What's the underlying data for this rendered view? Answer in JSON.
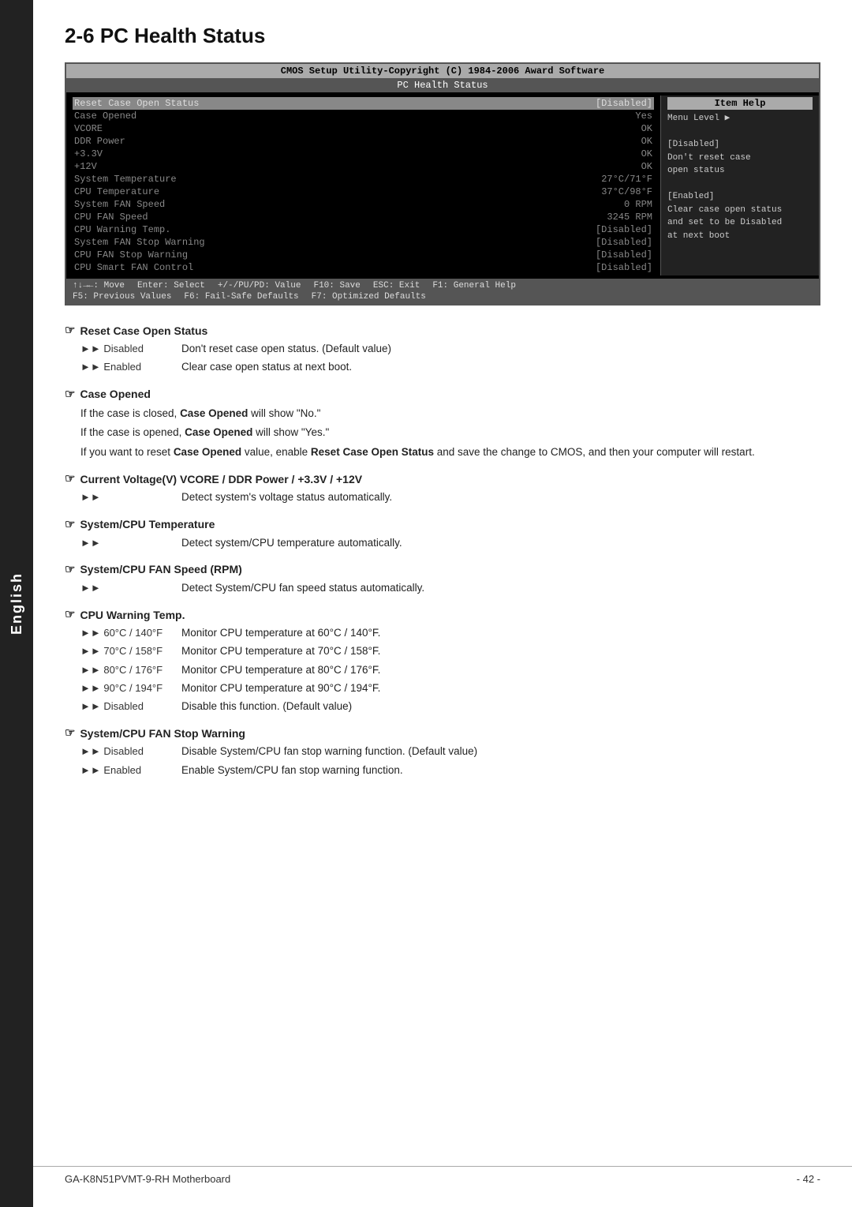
{
  "sidebar": {
    "label": "English"
  },
  "page": {
    "title_number": "2-6",
    "title_text": "PC Health Status"
  },
  "bios": {
    "header": "CMOS Setup Utility-Copyright (C) 1984-2006 Award Software",
    "subheader": "PC Health Status",
    "rows": [
      {
        "label": "Reset Case Open Status",
        "value": "[Disabled]",
        "selected": true,
        "dim": false
      },
      {
        "label": "Case Opened",
        "value": "Yes",
        "selected": false,
        "dim": true
      },
      {
        "label": "VCORE",
        "value": "OK",
        "selected": false,
        "dim": true
      },
      {
        "label": "DDR Power",
        "value": "OK",
        "selected": false,
        "dim": true
      },
      {
        "label": "+3.3V",
        "value": "OK",
        "selected": false,
        "dim": true
      },
      {
        "label": "+12V",
        "value": "OK",
        "selected": false,
        "dim": true
      },
      {
        "label": "System Temperature",
        "value": "27°C/71°F",
        "selected": false,
        "dim": true
      },
      {
        "label": "CPU Temperature",
        "value": "37°C/98°F",
        "selected": false,
        "dim": true
      },
      {
        "label": "System FAN Speed",
        "value": "0 RPM",
        "selected": false,
        "dim": true
      },
      {
        "label": "CPU FAN Speed",
        "value": "3245 RPM",
        "selected": false,
        "dim": true
      },
      {
        "label": "CPU Warning Temp.",
        "value": "[Disabled]",
        "selected": false,
        "dim": true
      },
      {
        "label": "System FAN Stop Warning",
        "value": "[Disabled]",
        "selected": false,
        "dim": true
      },
      {
        "label": "CPU FAN Stop Warning",
        "value": "[Disabled]",
        "selected": false,
        "dim": true
      },
      {
        "label": "CPU Smart FAN Control",
        "value": "[Disabled]",
        "selected": false,
        "dim": true
      }
    ],
    "help": {
      "title": "Item Help",
      "lines": [
        "Menu Level  ▶",
        "",
        "[Disabled]",
        "Don't reset case",
        "open status",
        "",
        "[Enabled]",
        "Clear case open status",
        "and set to be Disabled",
        "at next boot"
      ]
    },
    "footer": {
      "line1_left": "↑↓→←: Move",
      "line1_mid": "Enter: Select",
      "line1_right": "+/-/PU/PD: Value",
      "line1_f10": "F10: Save",
      "line1_esc": "ESC: Exit",
      "line1_f1": "F1: General Help",
      "line2_f5": "F5: Previous Values",
      "line2_f6": "F6: Fail-Safe Defaults",
      "line2_f7": "F7: Optimized Defaults"
    }
  },
  "sections": [
    {
      "id": "reset-case-open-status",
      "title": "Reset Case Open Status",
      "bullets": [
        {
          "label": "Disabled",
          "text": "Don't reset case open status. (Default value)"
        },
        {
          "label": "Enabled",
          "text": "Clear case open status at next boot."
        }
      ],
      "paragraphs": []
    },
    {
      "id": "case-opened",
      "title": "Case Opened",
      "bullets": [],
      "paragraphs": [
        "If the case is closed, Case Opened will show \"No.\"",
        "If the case is opened, Case Opened will show \"Yes.\"",
        "If you want to reset Case Opened value, enable Reset Case Open Status and save the change to CMOS, and then your computer will restart."
      ]
    },
    {
      "id": "current-voltage",
      "title": "Current Voltage(V) VCORE / DDR Power / +3.3V / +12V",
      "bullets": [
        {
          "label": "",
          "text": "Detect system's voltage status automatically."
        }
      ],
      "paragraphs": []
    },
    {
      "id": "system-cpu-temperature",
      "title": "System/CPU Temperature",
      "bullets": [
        {
          "label": "",
          "text": "Detect system/CPU temperature automatically."
        }
      ],
      "paragraphs": []
    },
    {
      "id": "system-cpu-fan-speed",
      "title": "System/CPU FAN Speed (RPM)",
      "bullets": [
        {
          "label": "",
          "text": "Detect System/CPU fan speed status automatically."
        }
      ],
      "paragraphs": []
    },
    {
      "id": "cpu-warning-temp",
      "title": "CPU Warning Temp.",
      "bullets": [
        {
          "label": "60°C / 140°F",
          "text": "Monitor CPU temperature at 60°C / 140°F."
        },
        {
          "label": "70°C / 158°F",
          "text": "Monitor CPU temperature at 70°C / 158°F."
        },
        {
          "label": "80°C / 176°F",
          "text": "Monitor CPU temperature at 80°C / 176°F."
        },
        {
          "label": "90°C / 194°F",
          "text": "Monitor CPU temperature at 90°C / 194°F."
        },
        {
          "label": "Disabled",
          "text": "Disable this function. (Default value)"
        }
      ],
      "paragraphs": []
    },
    {
      "id": "system-cpu-fan-stop-warning",
      "title": "System/CPU  FAN Stop Warning",
      "bullets": [
        {
          "label": "Disabled",
          "text": "Disable System/CPU fan stop warning function. (Default value)"
        },
        {
          "label": "Enabled",
          "text": "Enable System/CPU fan stop warning function."
        }
      ],
      "paragraphs": []
    }
  ],
  "footer": {
    "left": "GA-K8N51PVMT-9-RH Motherboard",
    "right": "- 42 -"
  }
}
